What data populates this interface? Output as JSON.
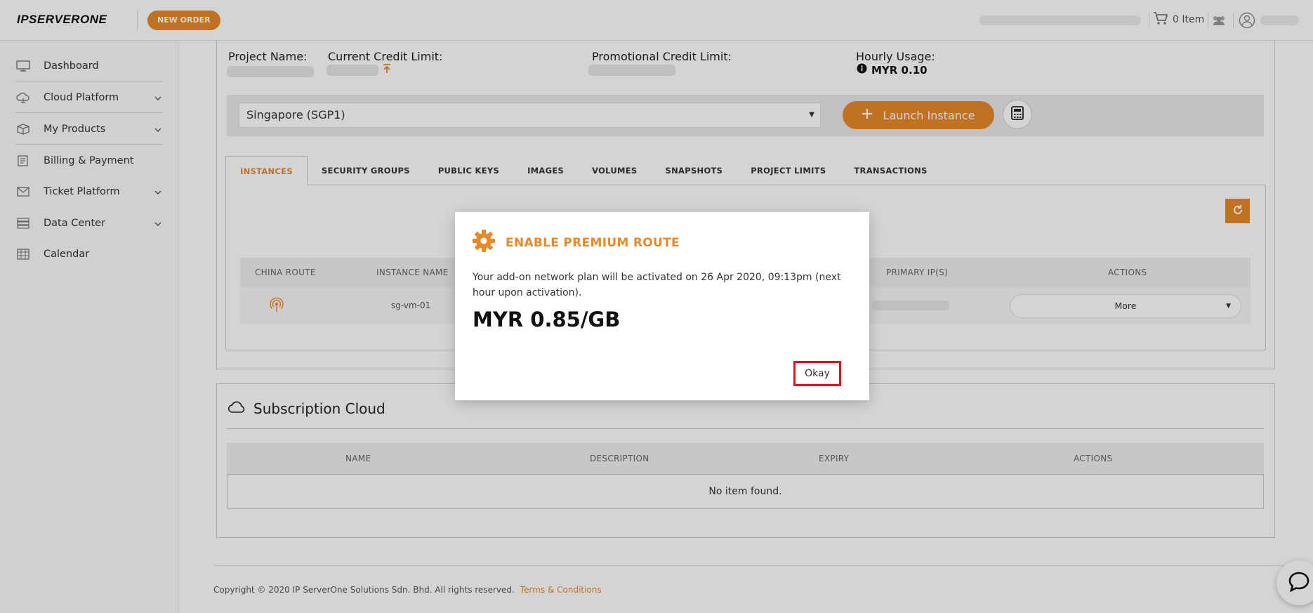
{
  "header": {
    "logo": "IPSERVERONE",
    "new_order": "NEW ORDER",
    "cart_label": "0 Item"
  },
  "sidebar": {
    "items": [
      {
        "label": "Dashboard"
      },
      {
        "label": "Cloud Platform"
      },
      {
        "label": "My Products"
      },
      {
        "label": "Billing & Payment"
      },
      {
        "label": "Ticket Platform"
      },
      {
        "label": "Data Center"
      },
      {
        "label": "Calendar"
      }
    ]
  },
  "project": {
    "project_name_label": "Project Name:",
    "credit_limit_label": "Current Credit Limit:",
    "promo_limit_label": "Promotional Credit Limit:",
    "hourly_usage_label": "Hourly Usage:",
    "hourly_usage_value": "MYR 0.10",
    "region": "Singapore (SGP1)",
    "launch_label": "Launch Instance"
  },
  "tabs": [
    {
      "label": "INSTANCES",
      "active": true
    },
    {
      "label": "SECURITY GROUPS"
    },
    {
      "label": "PUBLIC KEYS"
    },
    {
      "label": "IMAGES"
    },
    {
      "label": "VOLUMES"
    },
    {
      "label": "SNAPSHOTS"
    },
    {
      "label": "PROJECT LIMITS"
    },
    {
      "label": "TRANSACTIONS"
    }
  ],
  "instances_table": {
    "headers": [
      "CHINA ROUTE",
      "INSTANCE NAME",
      "PRIMARY IP(S)",
      "ACTIONS"
    ],
    "rows": [
      {
        "instance_name": "sg-vm-01",
        "action": "More"
      }
    ]
  },
  "subscription": {
    "title": "Subscription Cloud",
    "headers": [
      "NAME",
      "DESCRIPTION",
      "EXPIRY",
      "ACTIONS"
    ],
    "empty_text": "No item found."
  },
  "footer": {
    "copyright": "Copyright © 2020 IP ServerOne Solutions Sdn. Bhd. All rights reserved.",
    "terms": "Terms & Conditions"
  },
  "modal": {
    "title": "ENABLE PREMIUM ROUTE",
    "message": "Your add-on network plan will be activated on 26 Apr 2020, 09:13pm (next hour upon activation).",
    "price": "MYR 0.85/GB",
    "okay_label": "Okay"
  },
  "colors": {
    "accent": "#e8892a",
    "highlight": "#e0161b"
  }
}
